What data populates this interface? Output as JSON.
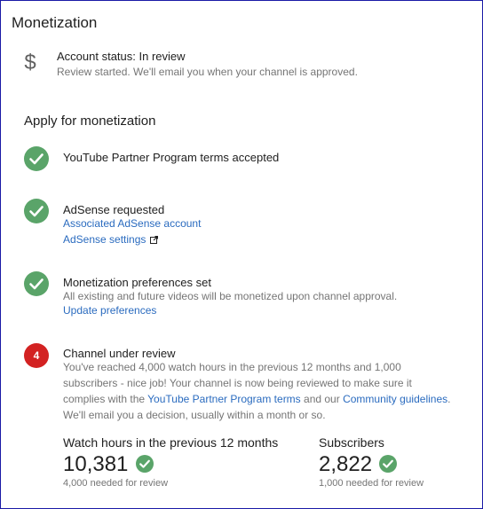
{
  "section_title": "Monetization",
  "account_status": {
    "icon": "dollar-icon",
    "title": "Account status: In review",
    "description": "Review started. We'll email you when your channel is approved."
  },
  "apply": {
    "title": "Apply for monetization",
    "step1": {
      "title": "YouTube Partner Program terms accepted"
    },
    "step2": {
      "title": "AdSense requested",
      "link1": "Associated AdSense account",
      "link2": "AdSense settings"
    },
    "step3": {
      "title": "Monetization preferences set",
      "text": "All existing and future videos will be monetized upon channel approval.",
      "link": "Update preferences"
    },
    "step4": {
      "number": "4",
      "title": "Channel under review",
      "line1": "You've reached 4,000 watch hours in the previous 12 months and 1,000",
      "line2": "subscribers - nice job! Your channel is now being reviewed to make sure it",
      "line3_prefix": "complies with the ",
      "line3_link1": "YouTube Partner Program terms",
      "line3_middle": " and our ",
      "line3_link2": "Community guidelines",
      "line3_suffix": ".",
      "line4": "We'll email you a decision, usually within a month or so."
    }
  },
  "stats": {
    "watch_hours": {
      "label": "Watch hours in the previous 12 months",
      "value": "10,381",
      "note": "4,000 needed for review"
    },
    "subscribers": {
      "label": "Subscribers",
      "value": "2,822",
      "note": "1,000 needed for review"
    }
  },
  "colors": {
    "check_green": "#5aa469",
    "step_red": "#d32222",
    "link_blue": "#2a6bbf"
  }
}
